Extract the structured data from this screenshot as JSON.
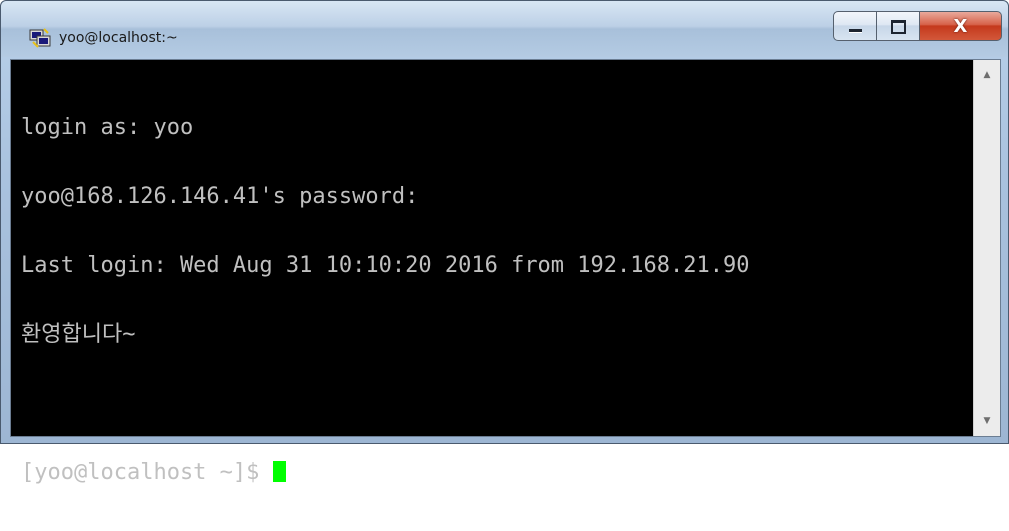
{
  "window": {
    "title": "yoo@localhost:~",
    "app_icon": "putty-icon",
    "controls": {
      "minimize_icon": "minimize-icon",
      "maximize_icon": "maximize-icon",
      "close_label": "X"
    }
  },
  "terminal": {
    "lines": [
      "login as: yoo",
      "yoo@168.126.146.41's password:",
      "Last login: Wed Aug 31 10:10:20 2016 from 192.168.21.90",
      "환영합니다~",
      "",
      "[yoo@localhost ~]$ "
    ],
    "foreground": "#c0c0c0",
    "background": "#000000",
    "cursor_color": "#00ff00"
  },
  "scrollbar": {
    "up_arrow": "▲",
    "down_arrow": "▼"
  }
}
